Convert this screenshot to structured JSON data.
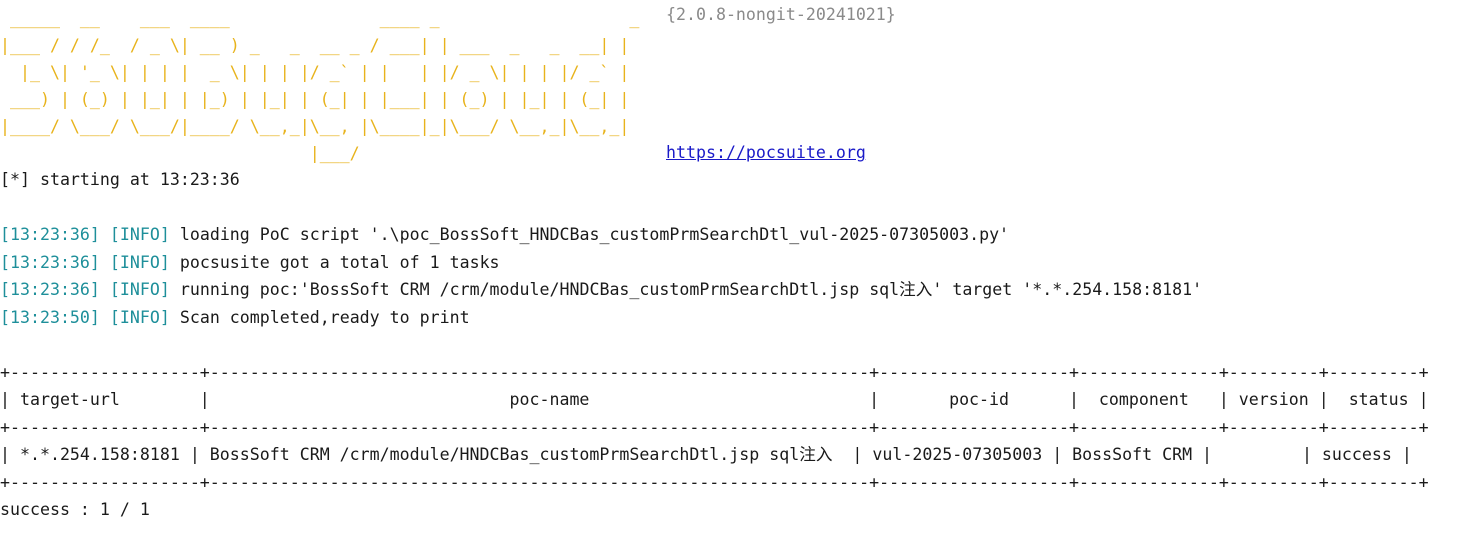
{
  "banner": {
    "lines": [
      " _____  __    ___  ____               ____ _                   _",
      "|___ / / /_  / _ \\| __ ) _   _  __ _ / ___| | ___  _   _  __| |",
      "  |_ \\| '_ \\| | | |  _ \\| | | |/ _` | |   | |/ _ \\| | | |/ _` |",
      " ___) | (_) | |_| | |_) | |_| | (_| | |___| | (_) | |_| | (_| |",
      "|____/ \\___/ \\___/|____/ \\__,_|\\__, |\\____|_|\\___/ \\__,_|\\__,_|",
      "                               |___/"
    ],
    "version": "{2.0.8-nongit-20241021}",
    "url": "https://pocsuite.org"
  },
  "start_line": "[*] starting at 13:23:36",
  "log": [
    {
      "time": "[13:23:36]",
      "level": "[INFO]",
      "message": "loading PoC script '.\\poc_BossSoft_HNDCBas_customPrmSearchDtl_vul-2025-07305003.py'"
    },
    {
      "time": "[13:23:36]",
      "level": "[INFO]",
      "message": "pocsusite got a total of 1 tasks"
    },
    {
      "time": "[13:23:36]",
      "level": "[INFO]",
      "message": "running poc:'BossSoft CRM /crm/module/HNDCBas_customPrmSearchDtl.jsp sql注入' target '*.*.254.158:8181'"
    },
    {
      "time": "[13:23:50]",
      "level": "[INFO]",
      "message": "Scan completed,ready to print"
    }
  ],
  "table": {
    "border": "+-------------------+------------------------------------------------------------------+-------------------+--------------+---------+---------+",
    "header_line": "| target-url        |                              poc-name                            |       poc-id      |  component   | version |  status |",
    "row_line": "| *.*.254.158:8181 | BossSoft CRM /crm/module/HNDCBas_customPrmSearchDtl.jsp sql注入  | vul-2025-07305003 | BossSoft CRM |         | success |",
    "headers": [
      "target-url",
      "poc-name",
      "poc-id",
      "component",
      "version",
      "status"
    ],
    "rows": [
      [
        "*.*.254.158:8181",
        "BossSoft CRM /crm/module/HNDCBas_customPrmSearchDtl.jsp sql注入",
        "vul-2025-07305003",
        "BossSoft CRM",
        "",
        "success"
      ]
    ]
  },
  "summary": "success : 1 / 1",
  "colors": {
    "banner": "#e8b31c",
    "timestamp": "#1e8f9a",
    "link": "#1a1ac8",
    "version": "#8a8a8a"
  }
}
